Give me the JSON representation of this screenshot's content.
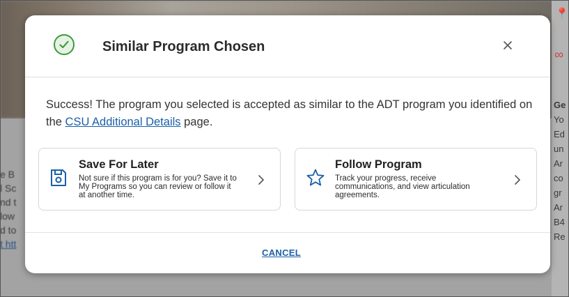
{
  "background": {
    "left_snippets": [
      "e B",
      "l Sc",
      "nd t",
      "low",
      "d to",
      "t htt"
    ],
    "right_snippets": [
      "Ge",
      "Yo",
      "Ed",
      "un",
      "Ar",
      "co",
      "gr",
      "Ar",
      "B4",
      "Re"
    ]
  },
  "modal": {
    "title": "Similar Program Chosen",
    "message_prefix": "Success! The program you selected is accepted as similar to the ADT program you identified on the ",
    "message_link": "CSU Additional Details",
    "message_suffix": " page.",
    "cards": [
      {
        "title": "Save For Later",
        "description": "Not sure if this program is for you? Save it to My Programs so you can review or follow it at another time.",
        "icon": "floppy-disk-icon"
      },
      {
        "title": "Follow Program",
        "description": "Track your progress, receive communications, and view articulation agreements.",
        "icon": "star-outline-icon"
      }
    ],
    "cancel_label": "CANCEL"
  },
  "colors": {
    "accent": "#1a5fa8",
    "success": "#3f9a3f"
  }
}
